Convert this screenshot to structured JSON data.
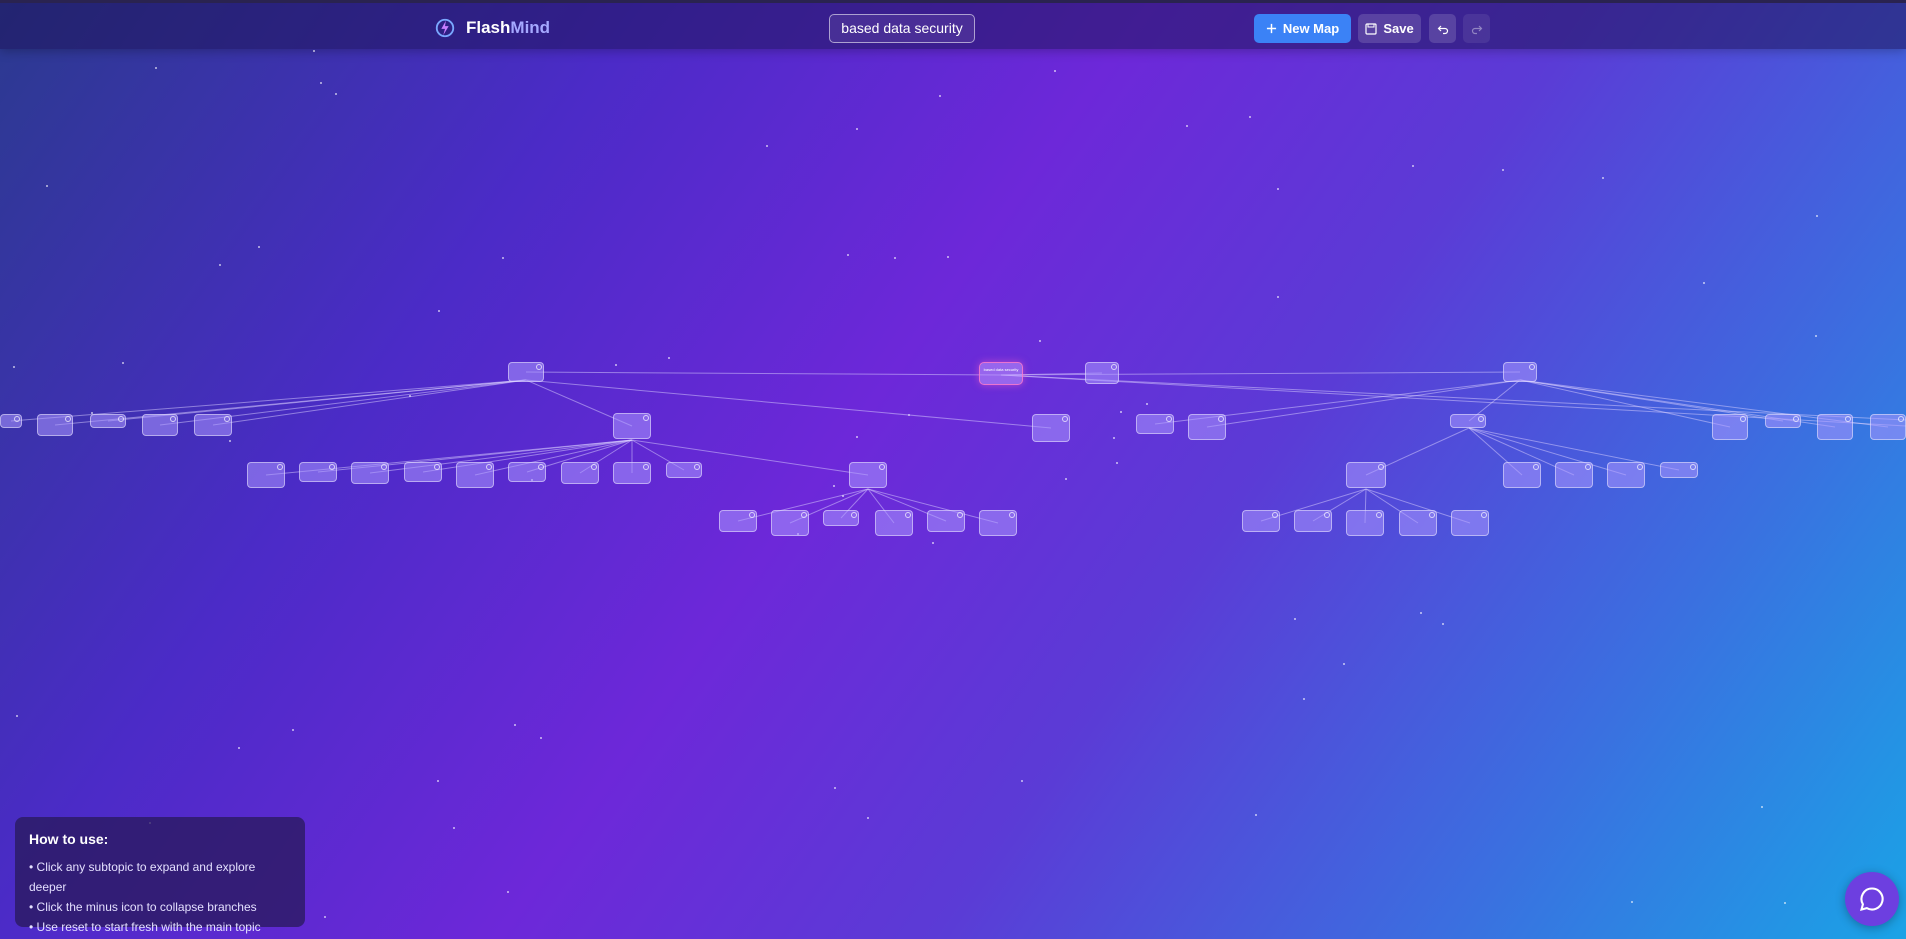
{
  "app": {
    "brand_primary": "Flash",
    "brand_secondary": "Mind",
    "map_title": "based data security"
  },
  "toolbar": {
    "new_map_label": "New Map",
    "save_label": "Save"
  },
  "mindmap": {
    "root_label": "based data security"
  },
  "help": {
    "title": "How to use:",
    "lines": [
      "• Click any subtopic to expand and explore deeper",
      "• Click the minus icon to collapse branches",
      "• Use reset to start fresh with the main topic"
    ]
  },
  "colors": {
    "accent": "#3b82f6",
    "chat": "#6d3fe0"
  }
}
